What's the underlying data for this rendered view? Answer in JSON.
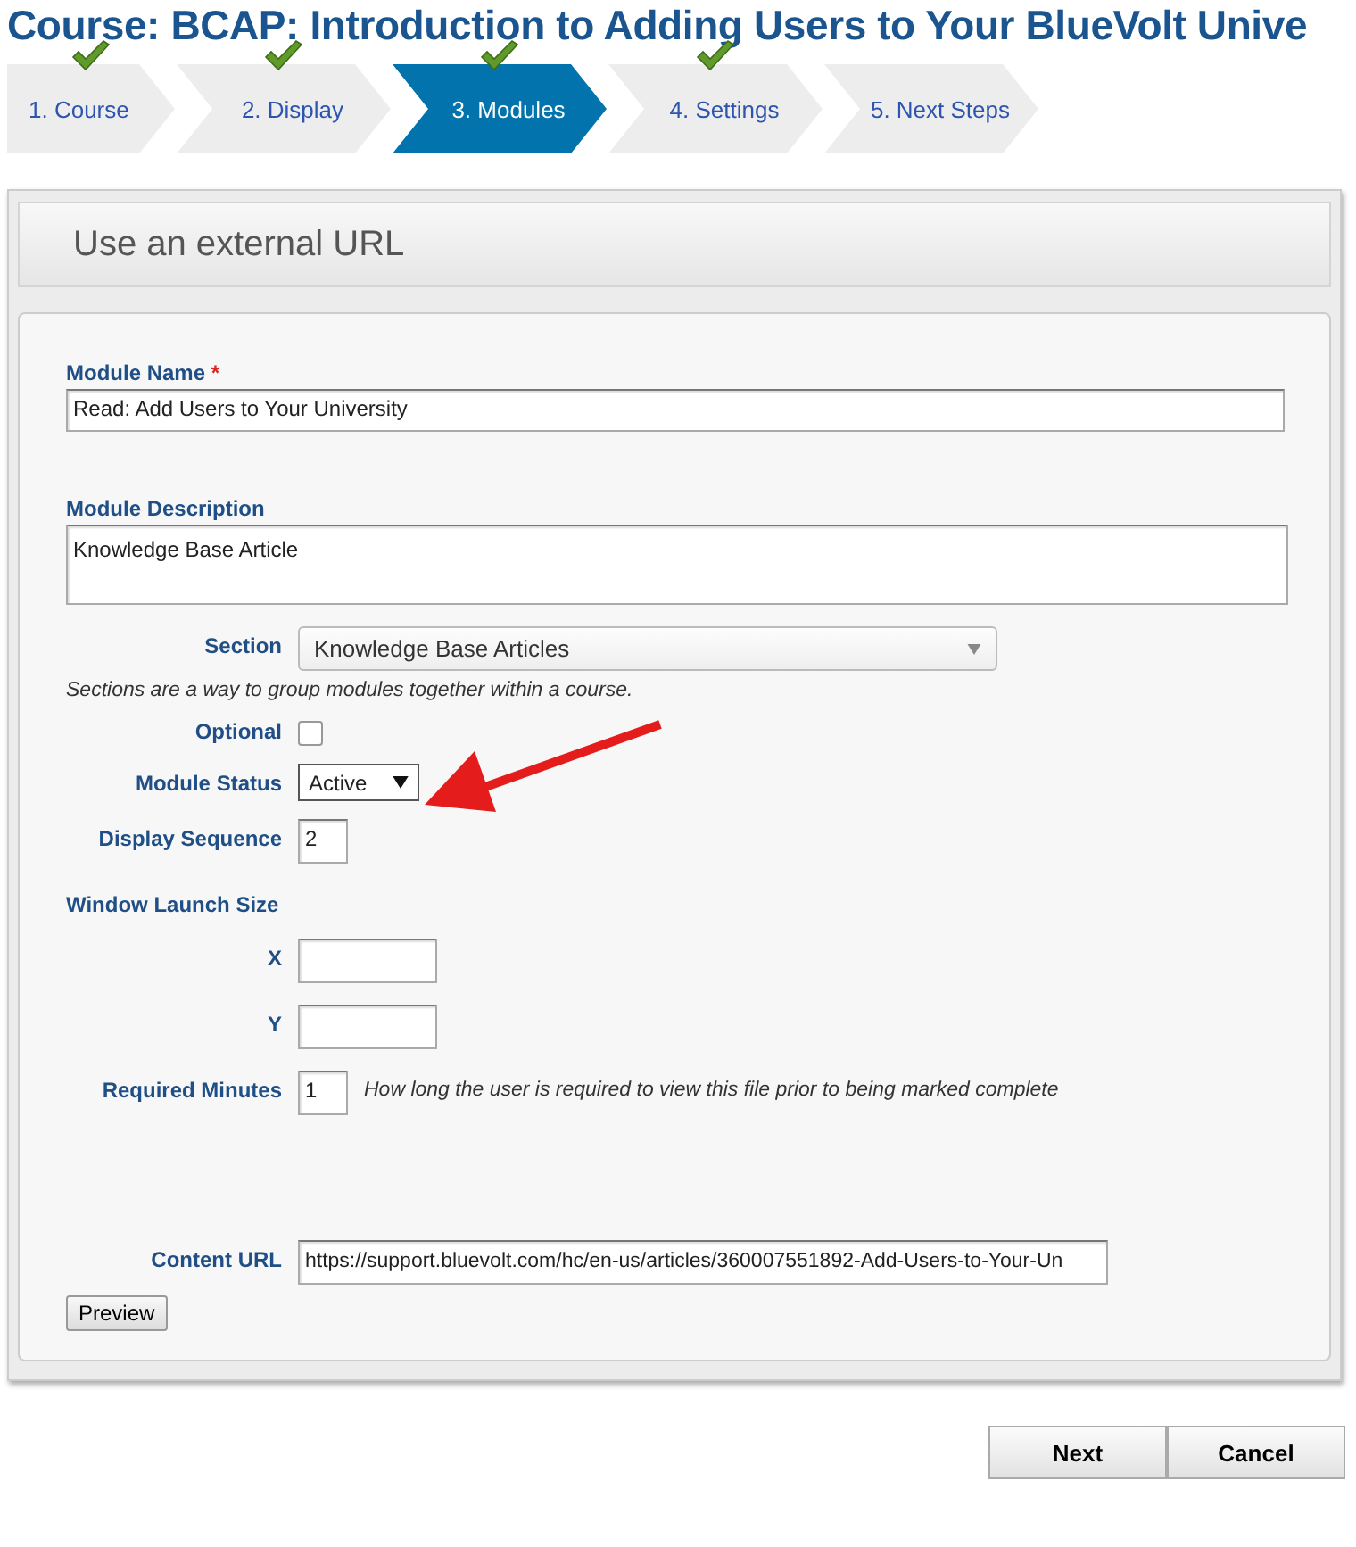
{
  "page_title": "Course: BCAP: Introduction to Adding Users to Your BlueVolt Unive",
  "steps": [
    {
      "label": "1. Course",
      "completed": true,
      "selected": false
    },
    {
      "label": "2. Display",
      "completed": true,
      "selected": false
    },
    {
      "label": "3. Modules",
      "completed": true,
      "selected": true
    },
    {
      "label": "4. Settings",
      "completed": true,
      "selected": false
    },
    {
      "label": "5. Next Steps",
      "completed": false,
      "selected": false
    }
  ],
  "panel_title": "Use an external URL",
  "form": {
    "module_name": {
      "label": "Module Name",
      "required_mark": "*",
      "value": "Read: Add Users to Your University"
    },
    "module_description": {
      "label": "Module Description",
      "value": "Knowledge Base Article"
    },
    "section": {
      "label": "Section",
      "value": "Knowledge Base Articles",
      "hint": "Sections are a way to group modules together within a course."
    },
    "optional": {
      "label": "Optional",
      "checked": false
    },
    "module_status": {
      "label": "Module Status",
      "value": "Active"
    },
    "display_sequence": {
      "label": "Display Sequence",
      "value": "2"
    },
    "window_launch_size": {
      "label": "Window Launch Size",
      "x_label": "X",
      "y_label": "Y"
    },
    "required_minutes": {
      "label": "Required Minutes",
      "value": "1",
      "hint": "How long the user is required to view this file prior to being marked complete"
    },
    "content_url": {
      "label": "Content URL",
      "value": "https://support.bluevolt.com/hc/en-us/articles/360007551892-Add-Users-to-Your-Un"
    },
    "preview_button": "Preview"
  },
  "buttons": [
    "Next",
    "Cancel"
  ]
}
